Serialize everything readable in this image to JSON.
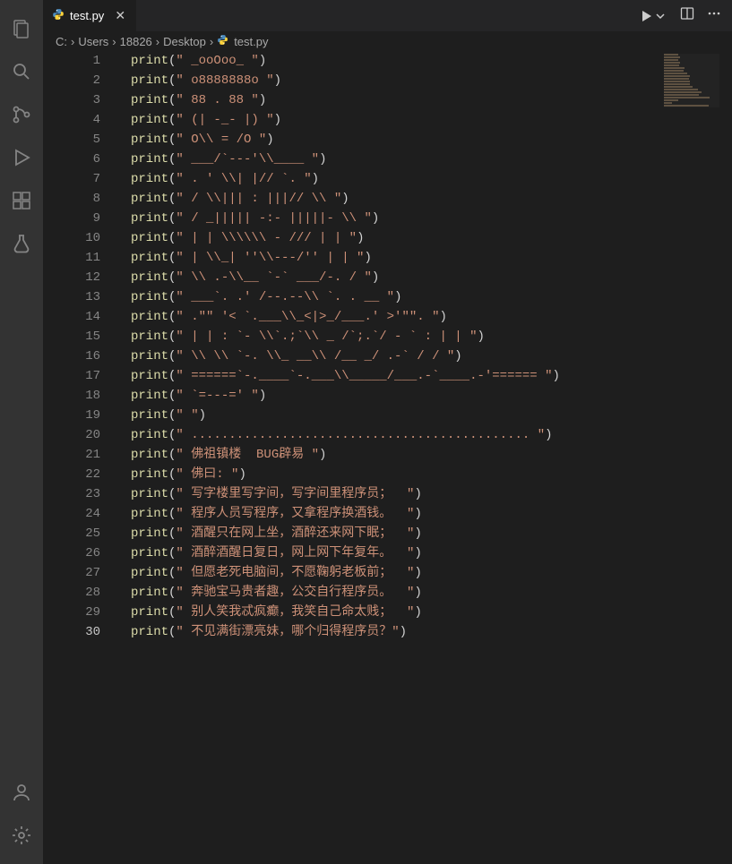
{
  "tab": {
    "label": "test.py"
  },
  "breadcrumb": {
    "c": "C:",
    "users": "Users",
    "num": "18826",
    "desktop": "Desktop",
    "file": "test.py"
  },
  "code": {
    "lines": [
      {
        "n": 1,
        "fn": "print",
        "s": "\" _ooOoo_ \""
      },
      {
        "n": 2,
        "fn": "print",
        "s": "\" o8888888o \""
      },
      {
        "n": 3,
        "fn": "print",
        "s": "\" 88 . 88 \""
      },
      {
        "n": 4,
        "fn": "print",
        "s": "\" (| -_- |) \""
      },
      {
        "n": 5,
        "fn": "print",
        "s": "\" O\\\\ = /O \""
      },
      {
        "n": 6,
        "fn": "print",
        "s": "\" ___/`---'\\\\____ \""
      },
      {
        "n": 7,
        "fn": "print",
        "s": "\" . ' \\\\| |// `. \""
      },
      {
        "n": 8,
        "fn": "print",
        "s": "\" / \\\\||| : |||// \\\\ \""
      },
      {
        "n": 9,
        "fn": "print",
        "s": "\" / _||||| -:- |||||- \\\\ \""
      },
      {
        "n": 10,
        "fn": "print",
        "s": "\" | | \\\\\\\\\\\\ - /// | | \""
      },
      {
        "n": 11,
        "fn": "print",
        "s": "\" | \\\\_| ''\\\\---/'' | | \""
      },
      {
        "n": 12,
        "fn": "print",
        "s": "\" \\\\ .-\\\\__ `-` ___/-. / \""
      },
      {
        "n": 13,
        "fn": "print",
        "s": "\" ___`. .' /--.--\\\\ `. . __ \""
      },
      {
        "n": 14,
        "fn": "print",
        "s": "\" .\"\" '< `.___\\\\_<|>_/___.' >'\"\". \""
      },
      {
        "n": 15,
        "fn": "print",
        "s": "\" | | : `- \\\\`.;`\\\\ _ /`;.`/ - ` : | | \""
      },
      {
        "n": 16,
        "fn": "print",
        "s": "\" \\\\ \\\\ `-. \\\\_ __\\\\ /__ _/ .-` / / \""
      },
      {
        "n": 17,
        "fn": "print",
        "s": "\" ======`-.____`-.___\\\\_____/___.-`____.-'====== \""
      },
      {
        "n": 18,
        "fn": "print",
        "s": "\" `=---=' \""
      },
      {
        "n": 19,
        "fn": "print",
        "s": "\" \""
      },
      {
        "n": 20,
        "fn": "print",
        "s": "\" ............................................. \""
      },
      {
        "n": 21,
        "fn": "print",
        "s": "\" 佛祖镇楼  BUG辟易 \""
      },
      {
        "n": 22,
        "fn": "print",
        "s": "\" 佛曰: \""
      },
      {
        "n": 23,
        "fn": "print",
        "s": "\" 写字楼里写字间，写字间里程序员；  \""
      },
      {
        "n": 24,
        "fn": "print",
        "s": "\" 程序人员写程序，又拿程序换酒钱。  \""
      },
      {
        "n": 25,
        "fn": "print",
        "s": "\" 酒醒只在网上坐，酒醉还来网下眠；  \""
      },
      {
        "n": 26,
        "fn": "print",
        "s": "\" 酒醉酒醒日复日，网上网下年复年。  \""
      },
      {
        "n": 27,
        "fn": "print",
        "s": "\" 但愿老死电脑间，不愿鞠躬老板前；  \""
      },
      {
        "n": 28,
        "fn": "print",
        "s": "\" 奔驰宝马贵者趣，公交自行程序员。  \""
      },
      {
        "n": 29,
        "fn": "print",
        "s": "\" 别人笑我忒疯癫，我笑自己命太贱；  \""
      },
      {
        "n": 30,
        "fn": "print",
        "s": "\" 不见满街漂亮妹，哪个归得程序员？\""
      }
    ],
    "current_line": 30
  }
}
